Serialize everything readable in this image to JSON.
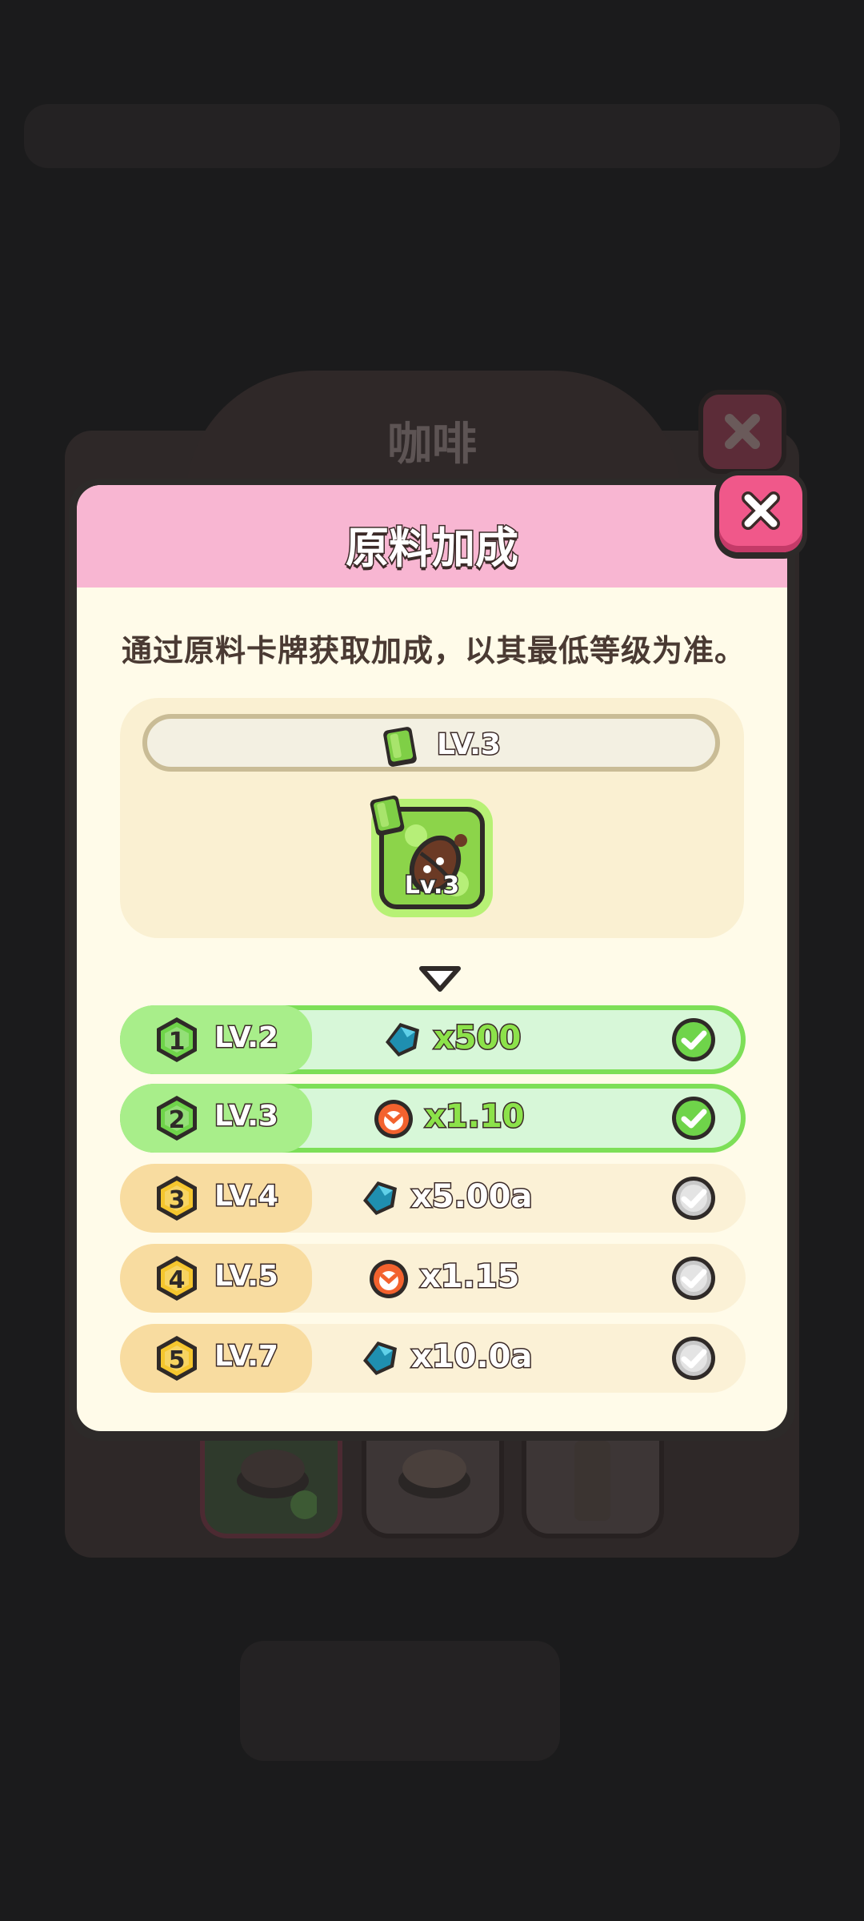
{
  "background": {
    "title": "咖啡"
  },
  "modal": {
    "title": "原料加成",
    "description": "通过原料卡牌获取加成，以其最低等级为准。",
    "current_level": "LV.3",
    "card_level": "Lv.3",
    "card_icon": "coffee-bean-icon"
  },
  "tiers": [
    {
      "step": "1",
      "level": "LV.2",
      "reward_icon": "blue-gem-icon",
      "value": "x500",
      "achieved": true
    },
    {
      "step": "2",
      "level": "LV.3",
      "reward_icon": "clock-multiplier-icon",
      "value": "x1.10",
      "achieved": true
    },
    {
      "step": "3",
      "level": "LV.4",
      "reward_icon": "blue-gem-icon",
      "value": "x5.00a",
      "achieved": false
    },
    {
      "step": "4",
      "level": "LV.5",
      "reward_icon": "clock-multiplier-icon",
      "value": "x1.15",
      "achieved": false
    },
    {
      "step": "5",
      "level": "LV.7",
      "reward_icon": "blue-gem-icon",
      "value": "x10.0a",
      "achieved": false
    }
  ],
  "colors": {
    "header_pink": "#f8b6d2",
    "close_pink": "#f0588a",
    "achieved_green": "#7ddf58",
    "pending_yellow": "#f8dca0"
  }
}
